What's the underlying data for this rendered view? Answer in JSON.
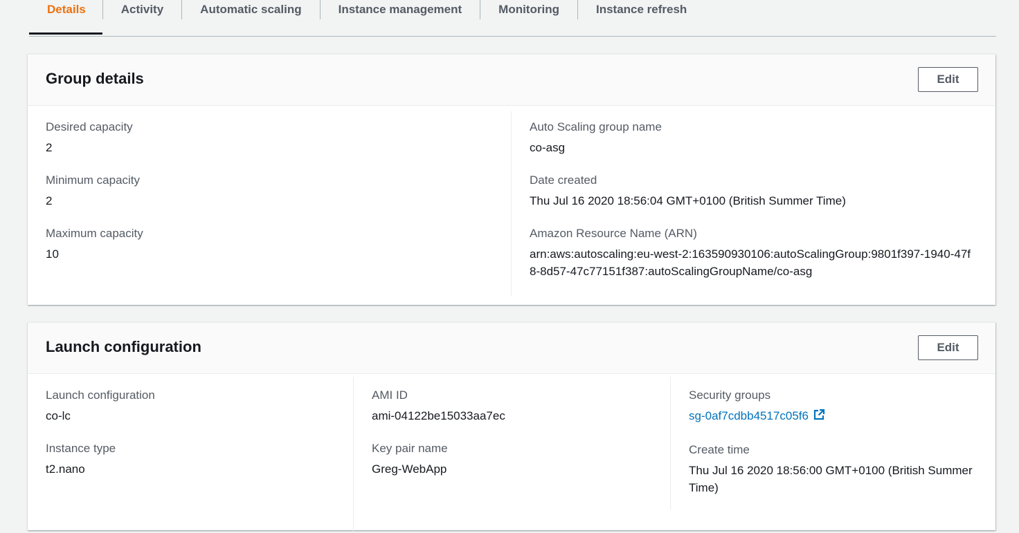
{
  "tabs": [
    {
      "label": "Details",
      "active": true
    },
    {
      "label": "Activity"
    },
    {
      "label": "Automatic scaling"
    },
    {
      "label": "Instance management"
    },
    {
      "label": "Monitoring"
    },
    {
      "label": "Instance refresh"
    }
  ],
  "group_details": {
    "title": "Group details",
    "edit_label": "Edit",
    "desired_capacity": {
      "label": "Desired capacity",
      "value": "2"
    },
    "minimum_capacity": {
      "label": "Minimum capacity",
      "value": "2"
    },
    "maximum_capacity": {
      "label": "Maximum capacity",
      "value": "10"
    },
    "asg_name": {
      "label": "Auto Scaling group name",
      "value": "co-asg"
    },
    "date_created": {
      "label": "Date created",
      "value": "Thu Jul 16 2020 18:56:04 GMT+0100 (British Summer Time)"
    },
    "arn": {
      "label": "Amazon Resource Name (ARN)",
      "value": "arn:aws:autoscaling:eu-west-2:163590930106:autoScalingGroup:9801f397-1940-47f8-8d57-47c77151f387:autoScalingGroupName/co-asg"
    }
  },
  "launch_configuration": {
    "title": "Launch configuration",
    "edit_label": "Edit",
    "launch_config": {
      "label": "Launch configuration",
      "value": "co-lc"
    },
    "instance_type": {
      "label": "Instance type",
      "value": "t2.nano"
    },
    "ami_id": {
      "label": "AMI ID",
      "value": "ami-04122be15033aa7ec"
    },
    "key_pair": {
      "label": "Key pair name",
      "value": "Greg-WebApp"
    },
    "security_groups": {
      "label": "Security groups",
      "value": "sg-0af7cdbb4517c05f6"
    },
    "create_time": {
      "label": "Create time",
      "value": "Thu Jul 16 2020 18:56:00 GMT+0100 (British Summer Time)"
    }
  },
  "colors": {
    "accent": "#ec7211",
    "link": "#0073bb",
    "text": "#16191f",
    "label": "#545b64"
  },
  "icons": {
    "external_link": "external-link-icon"
  }
}
